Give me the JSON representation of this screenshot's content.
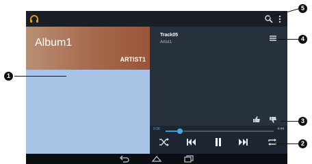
{
  "album": {
    "title": "Album1",
    "artist": "ARTIST1"
  },
  "track": {
    "title": "Track05",
    "artist": "Artist1"
  },
  "playback": {
    "elapsed": "0:36",
    "duration": "4:44",
    "progress": 0.13
  },
  "icons": {
    "app": "headphones-icon",
    "search": "search-icon",
    "overflow": "overflow-menu-icon",
    "queue": "queue-list-icon",
    "like": "thumbs-up-icon",
    "dislike": "thumbs-down-icon",
    "shuffle": "shuffle-icon",
    "previous": "skip-previous-icon",
    "pause": "pause-icon",
    "next": "skip-next-icon",
    "repeat": "repeat-icon",
    "back": "back-icon",
    "home": "home-icon",
    "recents": "recent-apps-icon"
  },
  "callouts": [
    "1",
    "2",
    "3",
    "4",
    "5"
  ],
  "colors": {
    "accent": "#3a9ad9",
    "app_icon": "#f0a500",
    "album_art": "#a6684c",
    "album_list": "#a8c3e6"
  }
}
